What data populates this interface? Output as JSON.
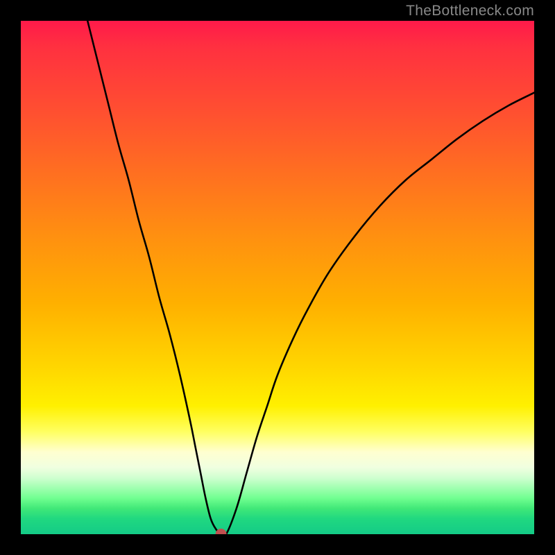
{
  "watermark_text": "TheBottleneck.com",
  "chart_data": {
    "type": "line",
    "title": "",
    "xlabel": "",
    "ylabel": "",
    "xlim": [
      0,
      100
    ],
    "ylim": [
      0,
      100
    ],
    "grid": false,
    "legend": false,
    "background": "rainbow-gradient-vertical",
    "series": [
      {
        "name": "bottleneck-curve",
        "color": "#000000",
        "x": [
          13,
          15,
          17,
          19,
          21,
          23,
          25,
          27,
          29,
          31,
          33,
          34,
          35,
          36,
          37,
          38,
          39,
          40,
          42,
          44,
          46,
          48,
          50,
          53,
          56,
          60,
          65,
          70,
          75,
          80,
          85,
          90,
          95,
          100
        ],
        "values": [
          100,
          92,
          84,
          76,
          69,
          61,
          54,
          46,
          39,
          31,
          22,
          17,
          12,
          7,
          3,
          1,
          0,
          0,
          5,
          12,
          19,
          25,
          31,
          38,
          44,
          51,
          58,
          64,
          69,
          73,
          77,
          80.5,
          83.5,
          86
        ]
      }
    ],
    "marker": {
      "name": "optimal-point",
      "x": 39,
      "y": 0,
      "color": "#c05050",
      "radius": 8
    }
  }
}
